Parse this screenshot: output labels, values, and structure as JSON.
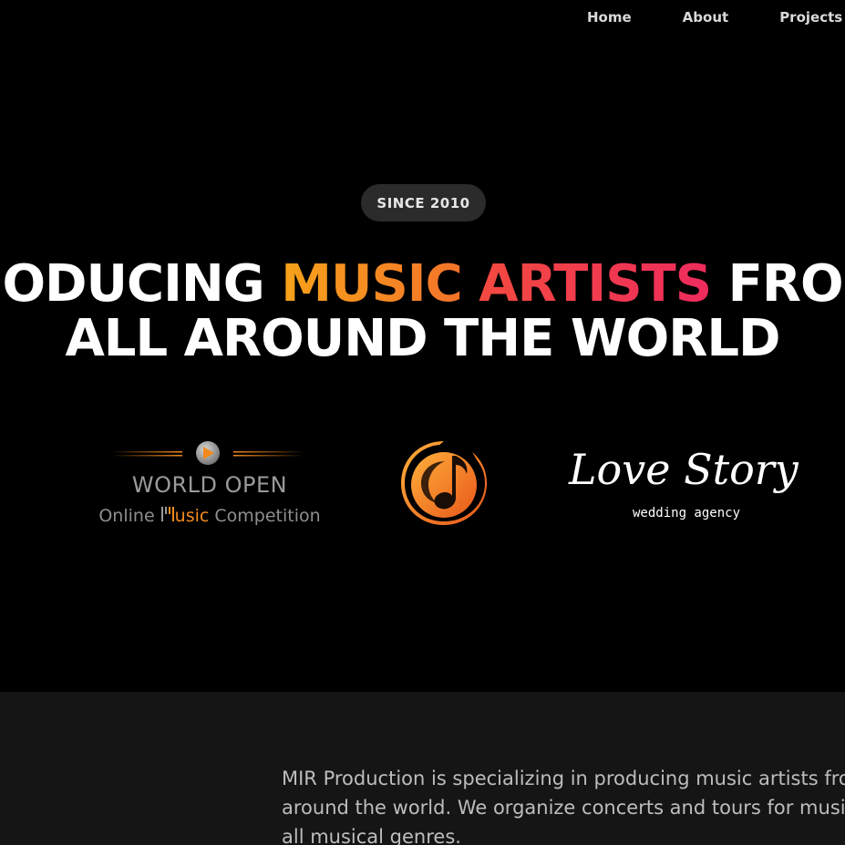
{
  "nav": {
    "items": [
      {
        "label": "Home"
      },
      {
        "label": "About"
      },
      {
        "label": "Projects"
      }
    ]
  },
  "hero": {
    "badge": "SINCE 2010",
    "headline": {
      "line1_prefix": "ODUCING ",
      "line1_highlight1": "MUSIC",
      "line1_space": " ",
      "line1_highlight2": "ARTISTS",
      "line1_suffix": " FRO",
      "line2": "ALL AROUND THE WORLD"
    },
    "gradient_colors": {
      "music_start": "#f6a21a",
      "music_end": "#f4732a",
      "artists_start": "#f34a3f",
      "artists_end": "#ee2b5d"
    }
  },
  "logos": {
    "world_open": {
      "title": "WORLD OPEN",
      "sub_prefix": "Online ",
      "sub_highlight": "usic",
      "sub_suffix": " Competition",
      "icon": "play-icon"
    },
    "music_note": {
      "icon": "music-note-icon"
    },
    "love_story": {
      "title": "Love Story",
      "subtitle": "wedding agency"
    }
  },
  "about": {
    "text": "MIR Production is specializing in producing music artists from all around the world. We organize concerts and tours for musicians of all musical genres."
  },
  "colors": {
    "background": "#000000",
    "section_background": "#151515",
    "badge_background": "#2b2b2b",
    "accent_orange": "#f28a1e"
  }
}
